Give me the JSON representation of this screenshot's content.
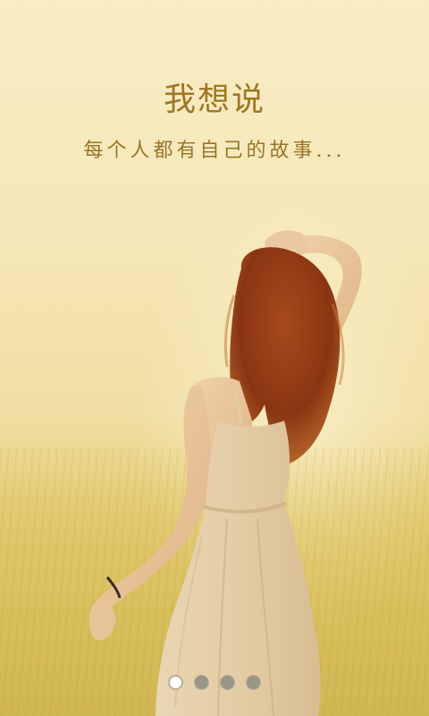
{
  "splash": {
    "title": "我想说",
    "subtitle": "每个人都有自己的故事..."
  },
  "illustration": {
    "subject": "woman-in-field-image",
    "colors": {
      "sky": "#f4e5b3",
      "field": "#dcc05c",
      "hair": "#8a3a16",
      "skin": "#e9c59a",
      "dress": "#e7d2ae",
      "text": "#a0761f"
    }
  },
  "pager": {
    "pages": [
      "page-1",
      "page-2",
      "page-3",
      "page-4"
    ],
    "active_index": 0
  }
}
